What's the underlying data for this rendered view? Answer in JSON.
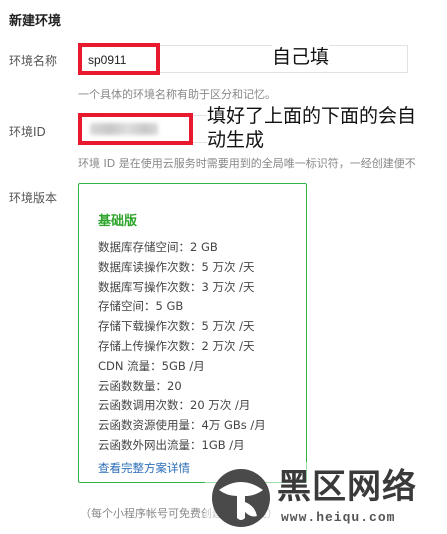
{
  "page": {
    "title": "新建环境"
  },
  "env_name": {
    "label": "环境名称",
    "value": "sp0911",
    "annotation": "自己填",
    "hint": "一个具体的环境名称有助于区分和记忆。"
  },
  "env_id": {
    "label": "环境ID",
    "annotation": "填好了上面的下面的会自动生成",
    "hint": "环境 ID 是在使用云服务时需要用到的全局唯一标识符，一经创建便不"
  },
  "env_version": {
    "label": "环境版本",
    "plan": {
      "name": "基础版",
      "features": [
        "数据库存储空间：2 GB",
        "数据库读操作次数：5 万次 /天",
        "数据库写操作次数：3 万次 /天",
        "存储空间：5 GB",
        "存储下载操作次数：5 万次 /天",
        "存储上传操作次数：2 万次 /天",
        "CDN 流量：5GB /月",
        "云函数数量：20",
        "云函数调用次数：20 万次 /月",
        "云函数资源使用量：4万 GBs /月",
        "云函数外网出流量：1GB /月"
      ],
      "link": "查看完整方案详情"
    },
    "footnote": "（每个小程序帐号可免费创建两个环境）"
  },
  "watermark": {
    "brand": "黑区网络",
    "url": "www.heiqu.com"
  },
  "colors": {
    "highlight_red": "#e8192c",
    "plan_green": "#2ea52b",
    "link_blue": "#2d6fb8"
  }
}
